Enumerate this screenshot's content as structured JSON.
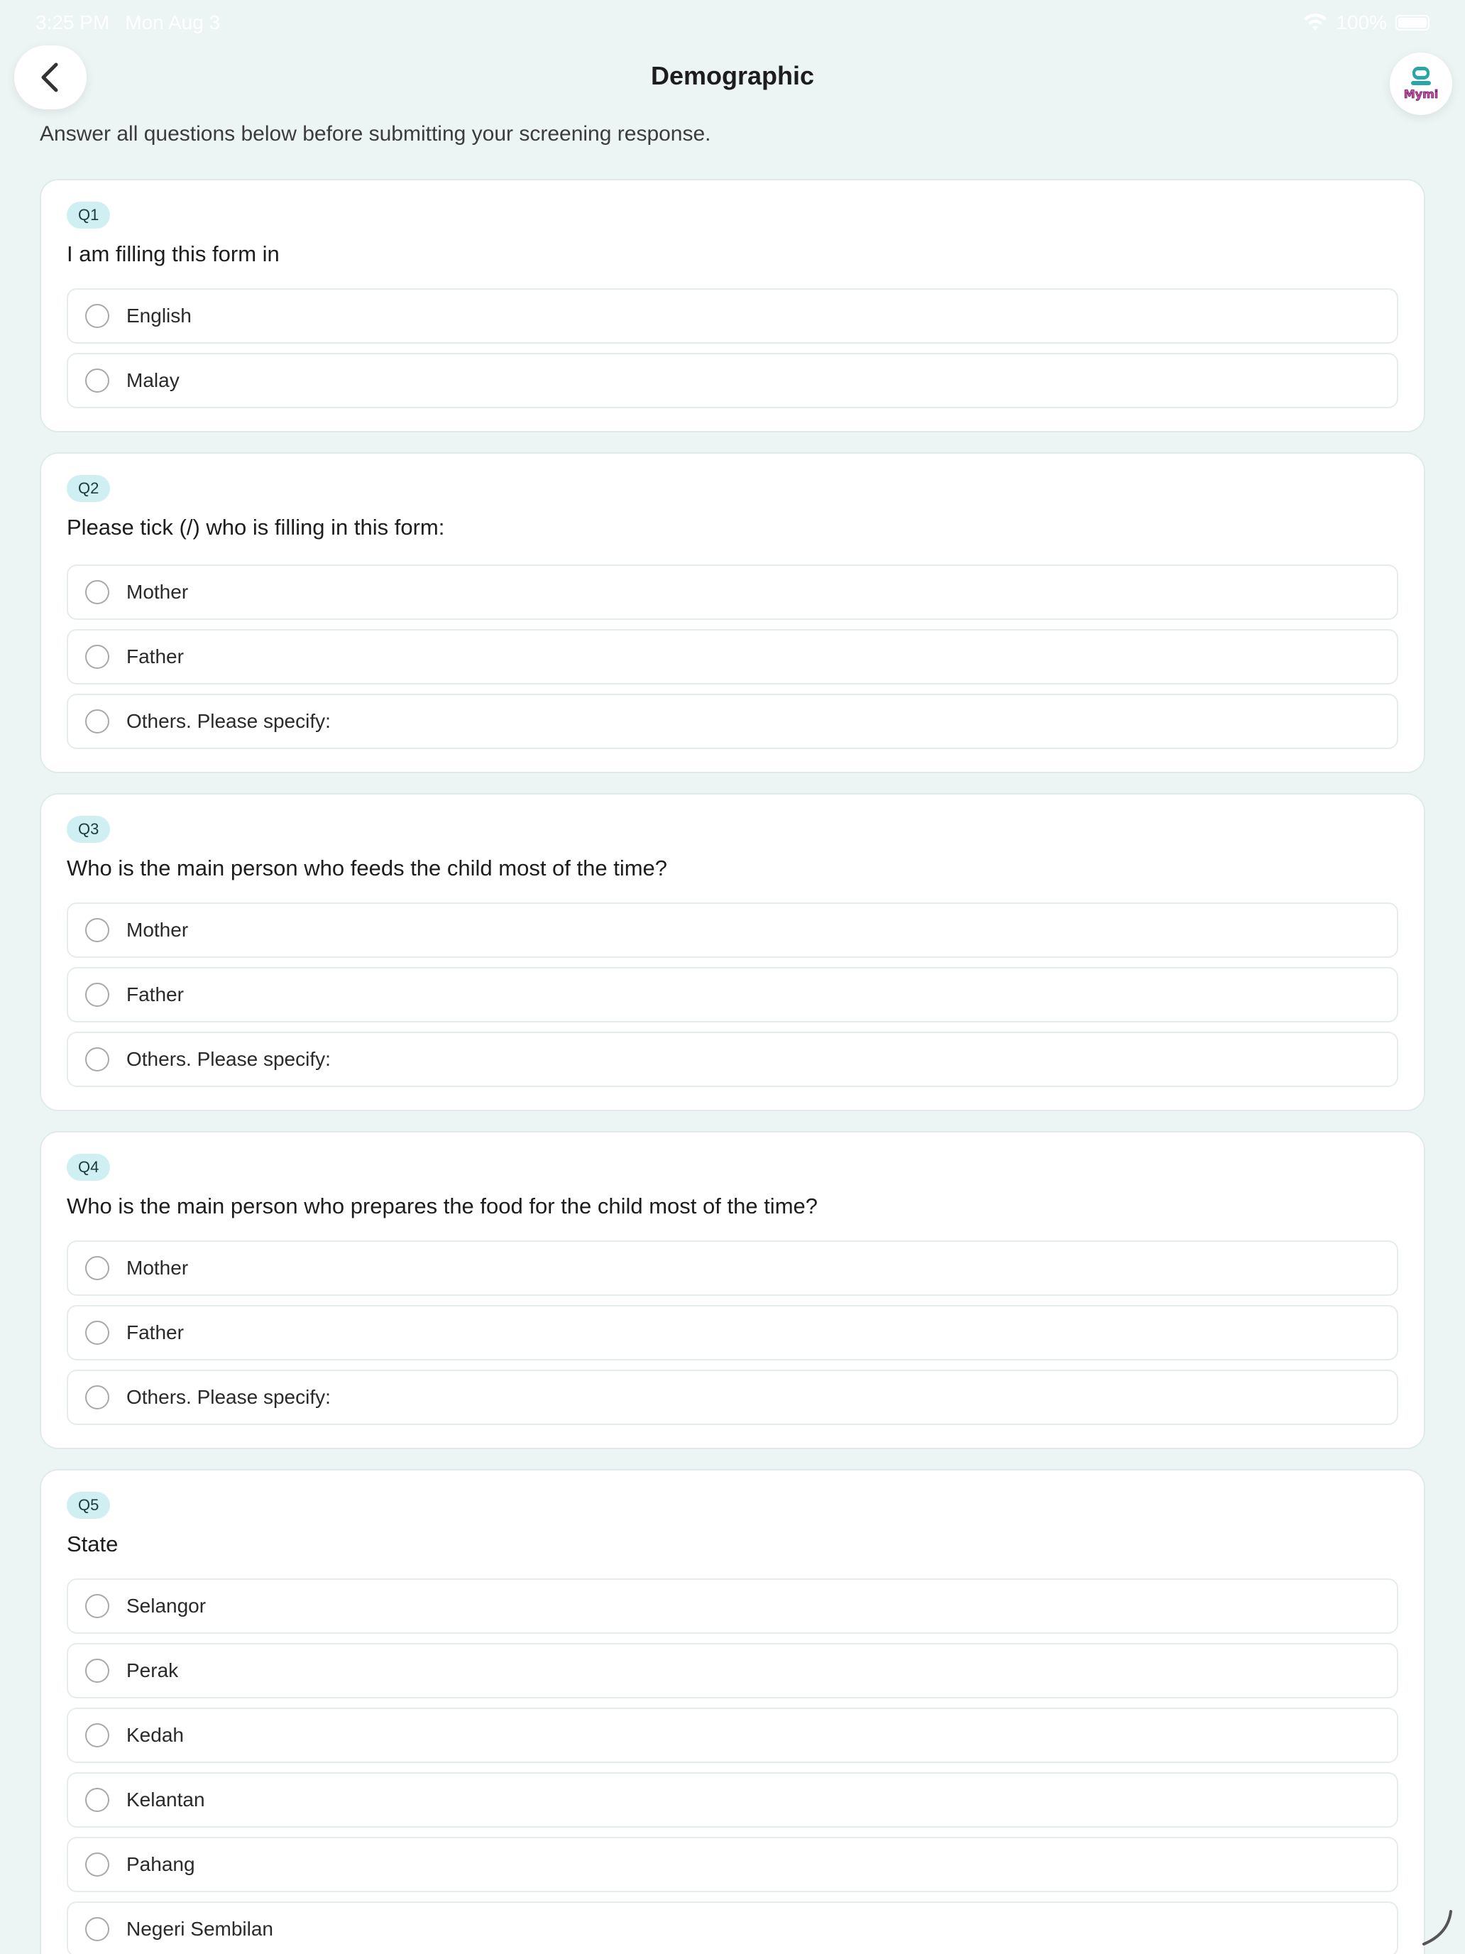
{
  "status_bar": {
    "time": "3:25 PM",
    "date": "Mon Aug 3",
    "battery": "100%"
  },
  "header": {
    "title": "Demographic",
    "back_icon": "chevron-left-icon",
    "avatar_logo_text": "Mymi"
  },
  "intro": "Answer all questions below before submitting your screening response.",
  "questions": [
    {
      "badge": "Q1",
      "text": "I am filling this form in",
      "options": [
        "English",
        "Malay"
      ]
    },
    {
      "badge": "Q2",
      "text": "Please tick (/) who is filling in this form:",
      "options": [
        "Mother",
        "Father",
        "Others. Please specify:"
      ]
    },
    {
      "badge": "Q3",
      "text": "Who is the main person who feeds the child most of the time?",
      "options": [
        "Mother",
        "Father",
        "Others. Please specify:"
      ]
    },
    {
      "badge": "Q4",
      "text": "Who is the main person who prepares the food for the child most of the time?",
      "options": [
        "Mother",
        "Father",
        "Others. Please specify:"
      ]
    },
    {
      "badge": "Q5",
      "text": "State",
      "options": [
        "Selangor",
        "Perak",
        "Kedah",
        "Kelantan",
        "Pahang",
        "Negeri Sembilan"
      ]
    }
  ],
  "colors": {
    "background": "#edf4f4",
    "badge": "#cfeff2",
    "card": "#ffffff"
  }
}
